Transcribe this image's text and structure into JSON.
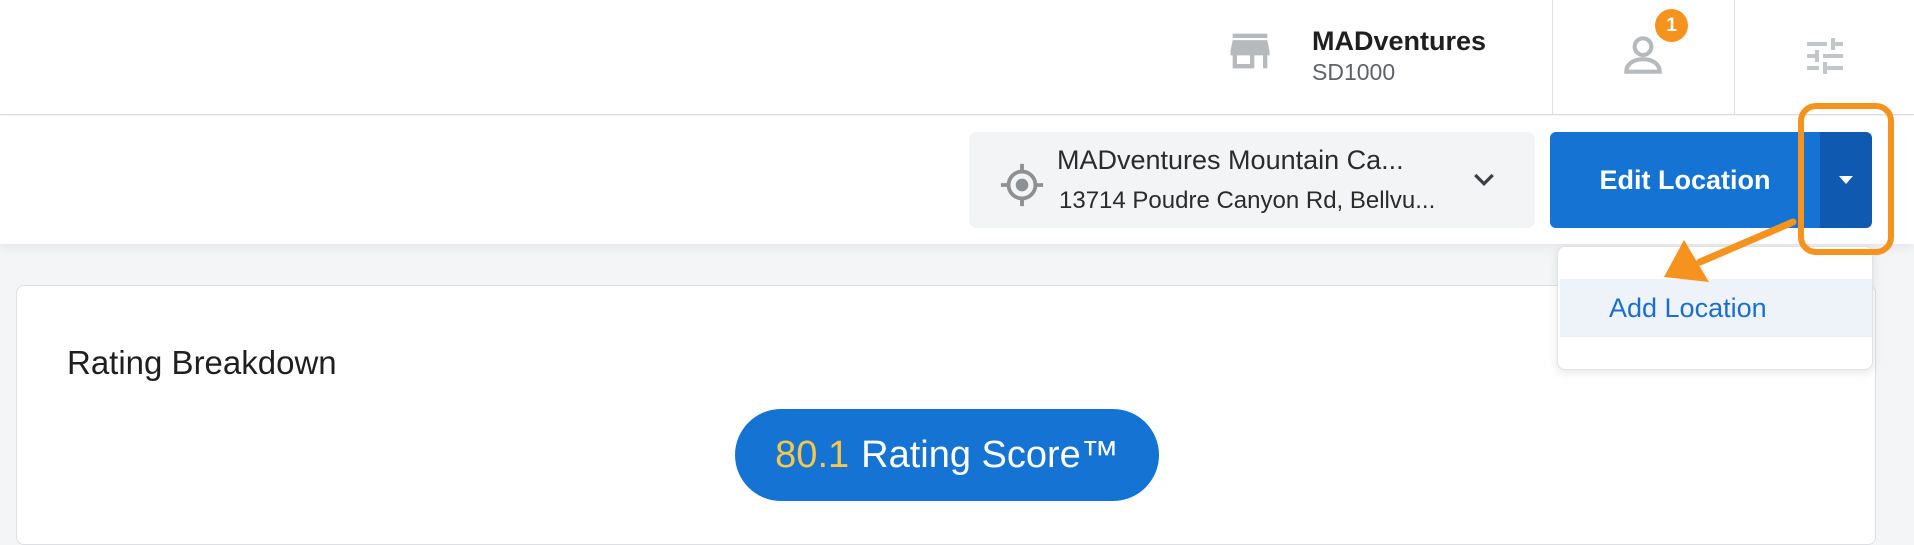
{
  "header": {
    "account_name": "MADventures",
    "account_id": "SD1000",
    "notification_count": "1",
    "icons": [
      "store-icon",
      "user-icon",
      "settings-sliders-icon"
    ]
  },
  "location_selector": {
    "name": "MADventures Mountain Ca...",
    "address": "13714 Poudre Canyon Rd, Bellvu...",
    "icon": "target-icon"
  },
  "actions": {
    "edit_label": "Edit Location",
    "dropdown_icon": "caret-down-icon"
  },
  "dropdown_menu": {
    "items": [
      {
        "label": "Add Location"
      }
    ]
  },
  "rating": {
    "title": "Rating Breakdown",
    "score": "80.1",
    "score_label": "Rating Score™"
  },
  "colors": {
    "primary": "#1473d3",
    "primary_dark": "#0f5ab0",
    "accent_orange": "#f6921e",
    "score_yellow": "#f5c74a"
  }
}
